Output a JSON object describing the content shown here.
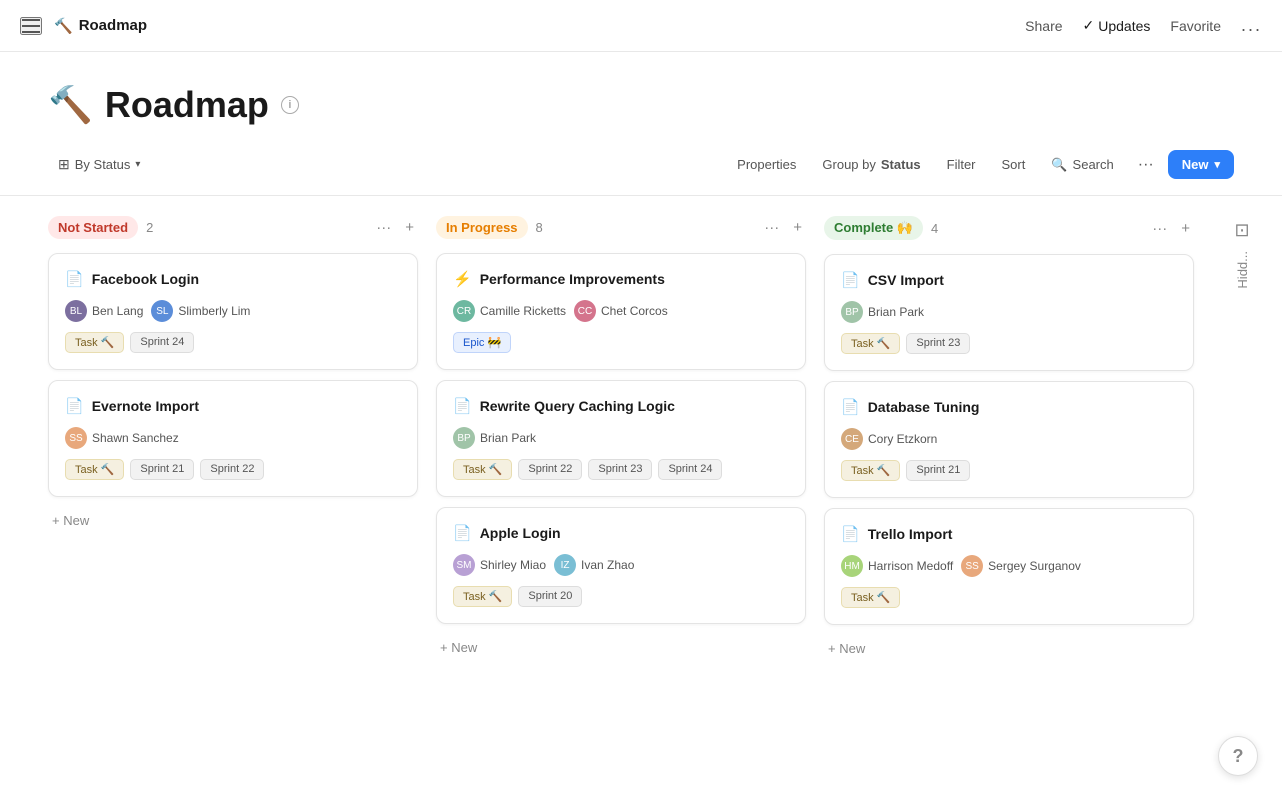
{
  "nav": {
    "hamburger_label": "menu",
    "page_icon": "🔨",
    "title": "Roadmap",
    "share_label": "Share",
    "updates_label": "Updates",
    "favorite_label": "Favorite",
    "more_label": "..."
  },
  "header": {
    "icon": "🔨",
    "title": "Roadmap",
    "info_label": "i"
  },
  "toolbar": {
    "view_label": "By Status",
    "properties_label": "Properties",
    "group_by_label": "Group by",
    "group_by_value": "Status",
    "filter_label": "Filter",
    "sort_label": "Sort",
    "search_label": "Search",
    "more_label": "···",
    "new_label": "New"
  },
  "columns": [
    {
      "id": "not-started",
      "status": "Not Started",
      "status_type": "not-started",
      "count": 2,
      "cards": [
        {
          "id": "facebook-login",
          "title": "Facebook Login",
          "icon": "📄",
          "assignees": [
            {
              "name": "Ben Lang",
              "avatar_class": "avatar-1"
            },
            {
              "name": "Slimberly Lim",
              "avatar_class": "avatar-2"
            }
          ],
          "tags": [
            {
              "label": "Task 🔨",
              "type": "task"
            },
            {
              "label": "Sprint 24",
              "type": "sprint"
            }
          ]
        },
        {
          "id": "evernote-import",
          "title": "Evernote Import",
          "icon": "📄",
          "assignees": [
            {
              "name": "Shawn Sanchez",
              "avatar_class": "avatar-3"
            }
          ],
          "tags": [
            {
              "label": "Task 🔨",
              "type": "task"
            },
            {
              "label": "Sprint 21",
              "type": "sprint"
            },
            {
              "label": "Sprint 22",
              "type": "sprint"
            }
          ]
        }
      ]
    },
    {
      "id": "in-progress",
      "status": "In Progress",
      "status_type": "in-progress",
      "count": 8,
      "cards": [
        {
          "id": "performance-improvements",
          "title": "Performance Improvements",
          "icon": "⚡",
          "assignees": [
            {
              "name": "Camille Ricketts",
              "avatar_class": "avatar-4"
            },
            {
              "name": "Chet Corcos",
              "avatar_class": "avatar-5"
            }
          ],
          "tags": [
            {
              "label": "Epic 🚧",
              "type": "epic"
            }
          ]
        },
        {
          "id": "rewrite-query-caching",
          "title": "Rewrite Query Caching Logic",
          "icon": "📄",
          "assignees": [
            {
              "name": "Brian Park",
              "avatar_class": "avatar-6"
            }
          ],
          "tags": [
            {
              "label": "Task 🔨",
              "type": "task"
            },
            {
              "label": "Sprint 22",
              "type": "sprint"
            },
            {
              "label": "Sprint 23",
              "type": "sprint"
            },
            {
              "label": "Sprint 24",
              "type": "sprint"
            }
          ]
        },
        {
          "id": "apple-login",
          "title": "Apple Login",
          "icon": "📄",
          "assignees": [
            {
              "name": "Shirley Miao",
              "avatar_class": "avatar-7"
            },
            {
              "name": "Ivan Zhao",
              "avatar_class": "avatar-8"
            }
          ],
          "tags": [
            {
              "label": "Task 🔨",
              "type": "task"
            },
            {
              "label": "Sprint 20",
              "type": "sprint"
            }
          ]
        }
      ]
    },
    {
      "id": "complete",
      "status": "Complete 🙌",
      "status_type": "complete",
      "count": 4,
      "cards": [
        {
          "id": "csv-import",
          "title": "CSV Import",
          "icon": "📄",
          "assignees": [
            {
              "name": "Brian Park",
              "avatar_class": "avatar-6"
            }
          ],
          "tags": [
            {
              "label": "Task 🔨",
              "type": "task"
            },
            {
              "label": "Sprint 23",
              "type": "sprint"
            }
          ]
        },
        {
          "id": "database-tuning",
          "title": "Database Tuning",
          "icon": "📄",
          "assignees": [
            {
              "name": "Cory Etzkorn",
              "avatar_class": "avatar-9"
            }
          ],
          "tags": [
            {
              "label": "Task 🔨",
              "type": "task"
            },
            {
              "label": "Sprint 21",
              "type": "sprint"
            }
          ]
        },
        {
          "id": "trello-import",
          "title": "Trello Import",
          "icon": "📄",
          "assignees": [
            {
              "name": "Harrison Medoff",
              "avatar_class": "avatar-10"
            },
            {
              "name": "Sergey Surganov",
              "avatar_class": "avatar-3"
            }
          ],
          "tags": [
            {
              "label": "Task 🔨",
              "type": "task"
            }
          ]
        }
      ]
    }
  ],
  "hidden_column": {
    "label": "Hidd..."
  },
  "add_new_label": "+ New",
  "help_label": "?"
}
